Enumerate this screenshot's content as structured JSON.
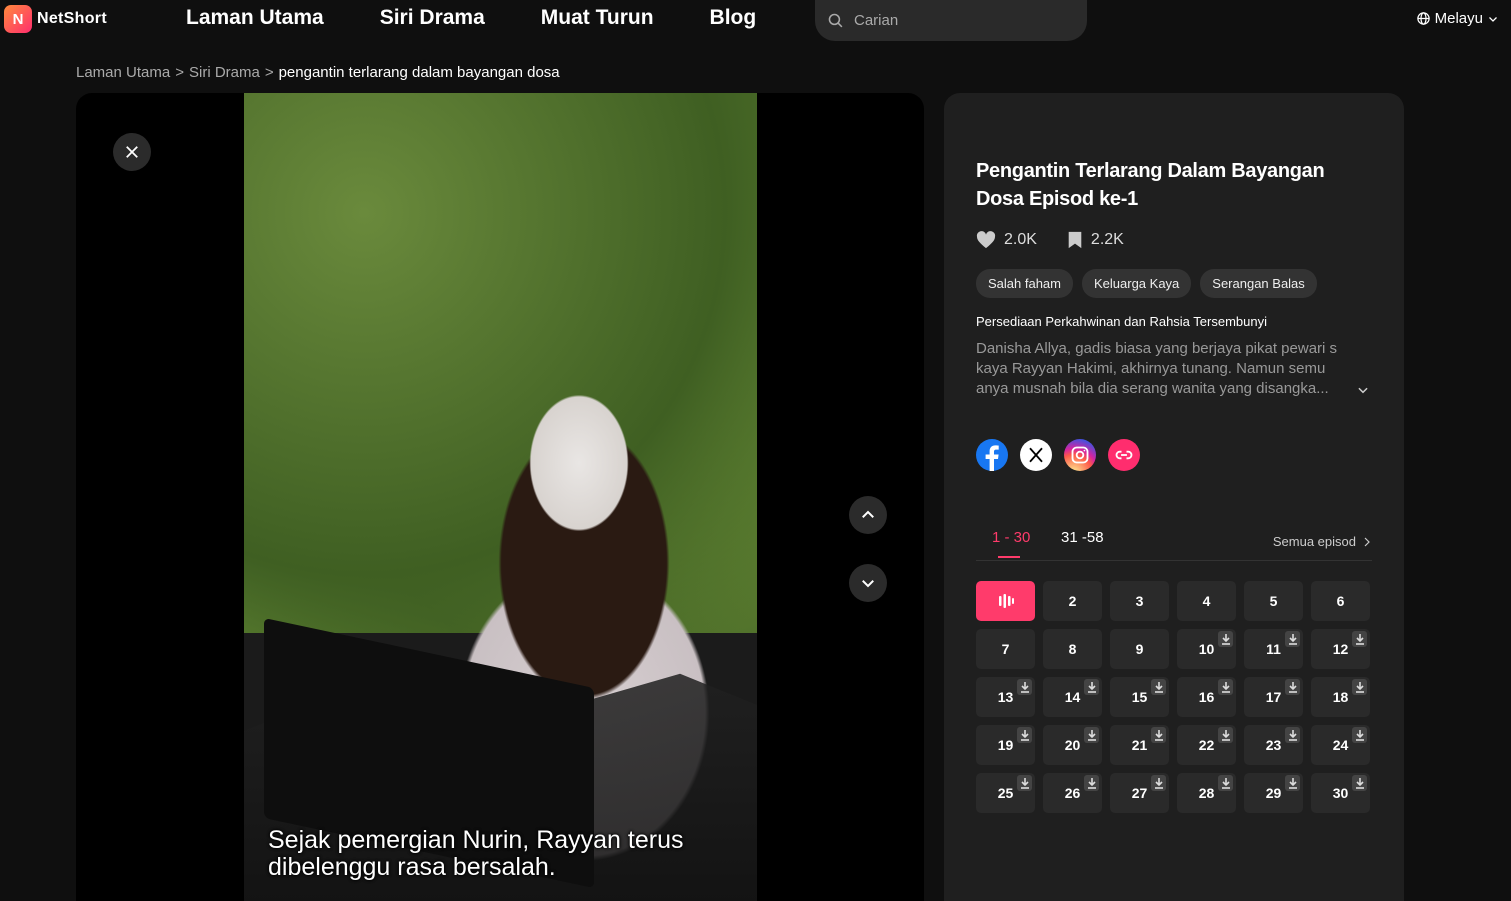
{
  "header": {
    "logo_text": "NetShort",
    "nav": [
      "Laman Utama",
      "Siri Drama",
      "Muat Turun",
      "Blog"
    ],
    "search_placeholder": "Carian",
    "language": "Melayu"
  },
  "breadcrumb": {
    "home": "Laman Utama",
    "section": "Siri Drama",
    "current": "pengantin terlarang dalam bayangan dosa",
    "separator": ">"
  },
  "video": {
    "subtitle": "Sejak pemergian Nurin, Rayyan terus dibelenggu rasa bersalah."
  },
  "info": {
    "title": "Pengantin Terlarang Dalam Bayangan Dosa Episod ke-1",
    "likes": "2.0K",
    "bookmarks": "2.2K",
    "tags": [
      "Salah faham",
      "Keluarga Kaya",
      "Serangan Balas"
    ],
    "subheading": "Persediaan Perkahwinan dan Rahsia Tersembunyi",
    "description": "Danisha Allya, gadis biasa yang berjaya pikat pewari s kaya Rayyan Hakimi, akhirnya tunang. Namun semu anya musnah bila dia serang wanita yang disangka..."
  },
  "episodes": {
    "tabs": [
      "1 - 30",
      "31 -58"
    ],
    "active_tab": 0,
    "all_label": "Semua episod",
    "current": 1,
    "list": [
      1,
      2,
      3,
      4,
      5,
      6,
      7,
      8,
      9,
      10,
      11,
      12,
      13,
      14,
      15,
      16,
      17,
      18,
      19,
      20,
      21,
      22,
      23,
      24,
      25,
      26,
      27,
      28,
      29,
      30
    ],
    "downloadable_from": 10
  },
  "colors": {
    "accent": "#ff3b6b",
    "panel": "#1f1f1f",
    "background": "#0f0f0f"
  }
}
